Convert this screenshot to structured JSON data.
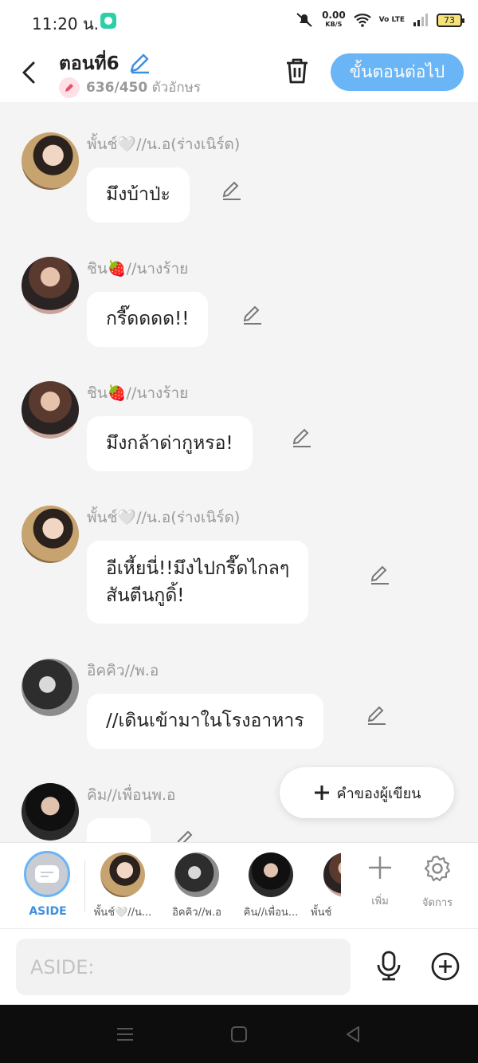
{
  "status": {
    "time": "11:20 น.",
    "speed": "0.00",
    "speed_unit": "KB/S",
    "volte": "Vo LTE",
    "battery": "73"
  },
  "header": {
    "title": "ตอนที่6",
    "char_count": "636/450",
    "char_count_unit": "ตัวอักษร",
    "next_label": "ขั้นตอนต่อไป"
  },
  "messages": [
    {
      "sender": "พั้นช์🤍//น.อ(ร่างเนิร์ด)",
      "text": "มึงบ้าป่ะ",
      "avatar": "girl-cat"
    },
    {
      "sender": "ชิน🍓//นางร้าย",
      "text": "กรี๊ดดดด!!",
      "avatar": "girl-dress"
    },
    {
      "sender": "ชิน🍓//นางร้าย",
      "text": "มึงกล้าด่ากูหรอ!",
      "avatar": "girl-dress"
    },
    {
      "sender": "พั้นช์🤍//น.อ(ร่างเนิร์ด)",
      "text_lines": [
        "อีเหี้ยนี่!!มึงไปกรี๊ดไกลๆ",
        "สันตีนกูดิ้!"
      ],
      "avatar": "girl-cat"
    },
    {
      "sender": "อิคคิว//พ.อ",
      "text": "//เดินเข้ามาในโรงอาหาร",
      "avatar": "boy-bw"
    },
    {
      "sender": "คิม//เพื่อนพ.อ",
      "text": "",
      "avatar": "boy-dark"
    }
  ],
  "author_note_label": "คำของผู้เขียน",
  "char_bar": {
    "aside_label": "ASIDE",
    "characters": [
      {
        "label": "พั้นช์🤍//น...",
        "avatar": "girl-cat"
      },
      {
        "label": "อิคคิว//พ.อ",
        "avatar": "boy-bw"
      },
      {
        "label": "คิน//เพื่อน...",
        "avatar": "boy-dark"
      },
      {
        "label": "พั้นช์",
        "avatar": "girl-dress"
      }
    ],
    "add_label": "เพิ่ม",
    "manage_label": "จัดการ"
  },
  "input": {
    "placeholder": "ASIDE:"
  },
  "colors": {
    "accent": "#6ab5f5",
    "aside_label": "#3d8fe0",
    "pink": "#e8506f"
  }
}
